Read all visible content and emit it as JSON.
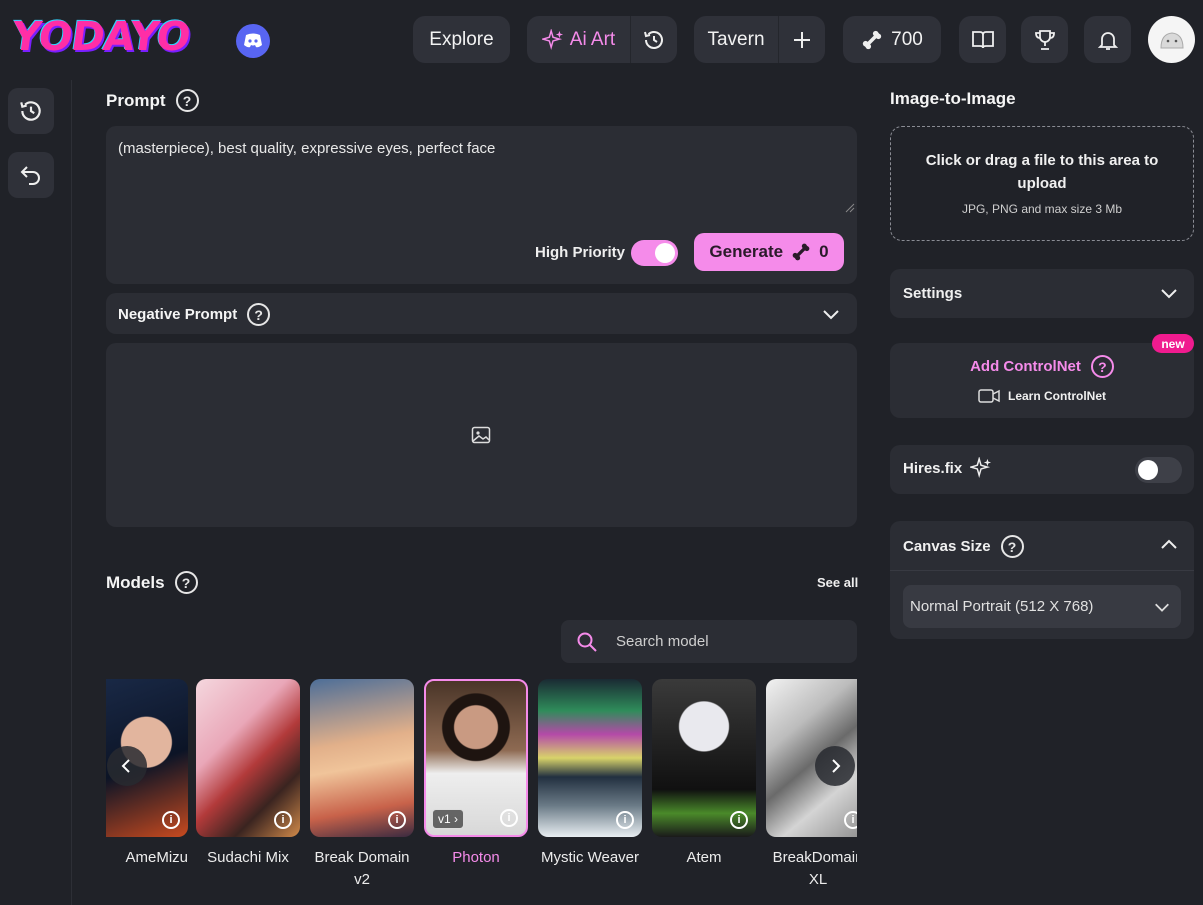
{
  "header": {
    "logo_text": "YODAYO",
    "explore": "Explore",
    "ai_art": "Ai Art",
    "tavern": "Tavern",
    "credits": "700"
  },
  "prompt": {
    "title": "Prompt",
    "value": "(masterpiece), best quality, expressive eyes, perfect face",
    "high_priority_label": "High Priority",
    "high_priority_on": true,
    "generate_label": "Generate",
    "generate_cost": "0"
  },
  "negative_prompt": {
    "title": "Negative Prompt"
  },
  "models": {
    "title": "Models",
    "see_all": "See all",
    "search_placeholder": "Search model",
    "items": [
      {
        "name": "AmeMizu",
        "selected": false
      },
      {
        "name": "Sudachi Mix",
        "selected": false
      },
      {
        "name": "Break Domain v2",
        "selected": false
      },
      {
        "name": "Photon",
        "selected": true,
        "version": "v1"
      },
      {
        "name": "Mystic Weaver",
        "selected": false
      },
      {
        "name": "Atem",
        "selected": false
      },
      {
        "name": "BreakDomain XL",
        "selected": false
      }
    ]
  },
  "img2img": {
    "title": "Image-to-Image",
    "upload_text": "Click or drag a file to this area to upload",
    "upload_hint": "JPG, PNG and max size 3 Mb"
  },
  "settings": {
    "title": "Settings"
  },
  "controlnet": {
    "add_label": "Add ControlNet",
    "learn_label": "Learn ControlNet",
    "badge": "new"
  },
  "hires": {
    "title": "Hires.fix",
    "enabled": false
  },
  "canvas": {
    "title": "Canvas Size",
    "selected": "Normal Portrait (512 X 768)"
  },
  "colors": {
    "accent": "#f58bea",
    "background": "#202228",
    "panel": "#2b2d34",
    "badge": "#f01b8f"
  }
}
